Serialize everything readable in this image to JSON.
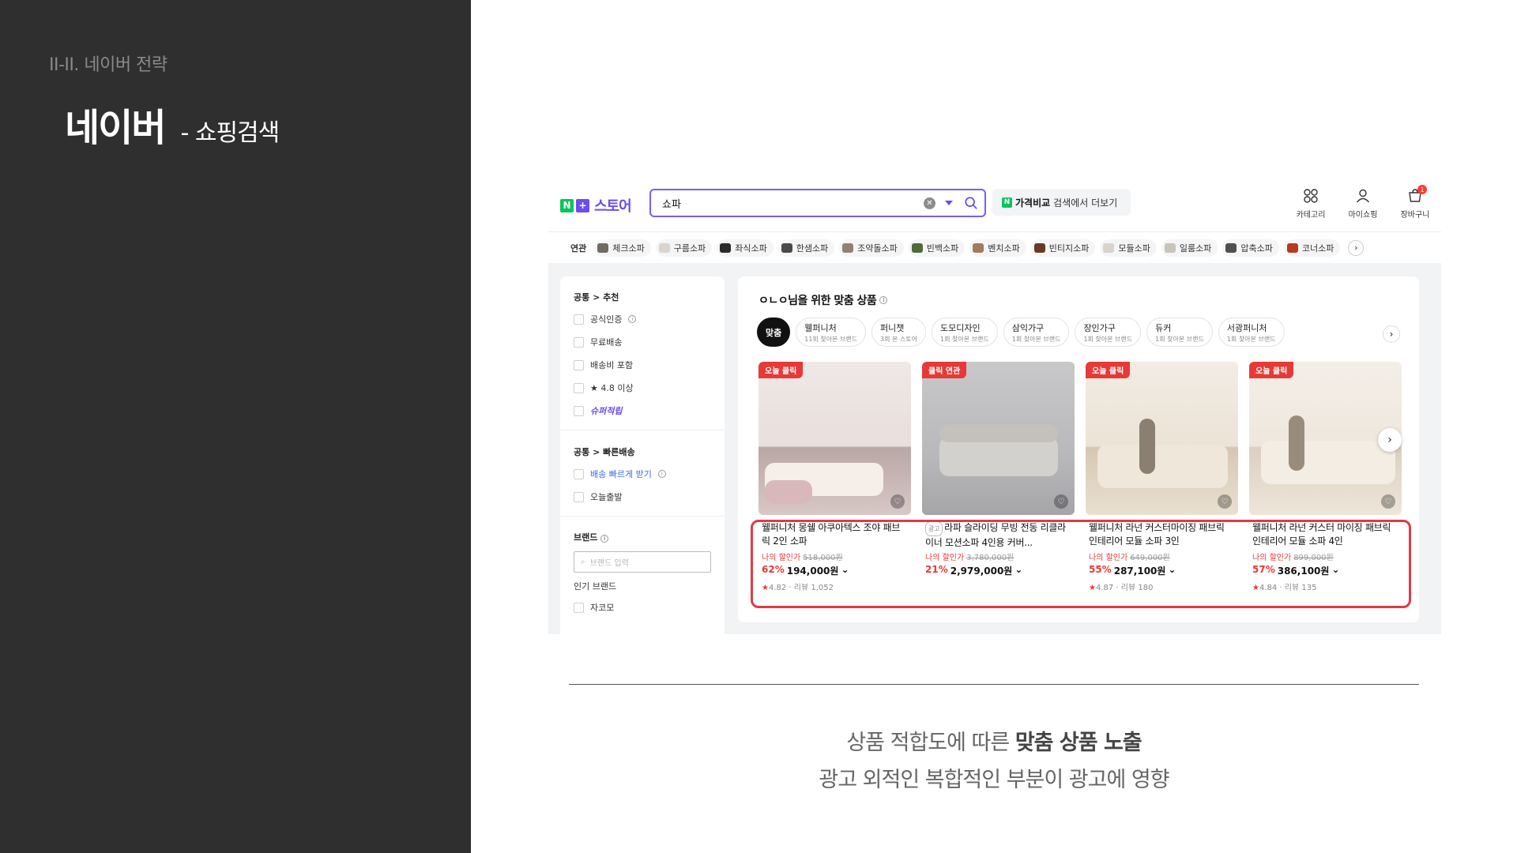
{
  "slide": {
    "section": "II-II. 네이버 전략",
    "title": "네이버",
    "subtitle": "- 쇼핑검색",
    "caption_line1_pre": "상품 적합도에 따른 ",
    "caption_line1_bold": "맞춤 상품 노출",
    "caption_line2": "광고 외적인 복합적인 부분이 광고에 영향"
  },
  "store": {
    "logo_text": "스토어",
    "search_value": "쇼파",
    "compare_bold": "가격비교",
    "compare_rest": "검색에서 더보기",
    "top_icons": [
      {
        "name": "category-icon",
        "label": "카테고리"
      },
      {
        "name": "user-icon",
        "label": "마이쇼핑"
      },
      {
        "name": "cart-icon",
        "label": "장바구니"
      }
    ],
    "cart_count": "1"
  },
  "related": {
    "label": "연관",
    "chips": [
      "체크소파",
      "구름소파",
      "좌식소파",
      "한샘소파",
      "조약돌소파",
      "빈백소파",
      "벤치소파",
      "빈티지소파",
      "모듈소파",
      "일룸소파",
      "압축소파",
      "코너소파"
    ]
  },
  "filters": {
    "section1": "공통 > 추천",
    "items1": [
      "공식인증",
      "무료배송",
      "배송비 포함",
      "★ 4.8 이상",
      "슈퍼적립"
    ],
    "section2": "공통 > 빠른배송",
    "fast_delivery": "배송 빠르게 받기",
    "today_ship": "오늘출발",
    "brand_title": "브랜드",
    "brand_placeholder": "브랜드 입력",
    "popular_brand": "인기 브랜드",
    "brand_item": "자코모"
  },
  "recommend": {
    "title": "ㅇㄴㅇ님을 위한 맞춤 상품",
    "active_tab": "맞춤",
    "tabs": [
      {
        "name": "웰퍼니처",
        "sub": "11회 찾아본 브랜드"
      },
      {
        "name": "퍼니챗",
        "sub": "3회 본 스토어"
      },
      {
        "name": "도모디자인",
        "sub": "1회 찾아본 브랜드"
      },
      {
        "name": "삼익가구",
        "sub": "1회 찾아본 브랜드"
      },
      {
        "name": "장인가구",
        "sub": "1회 찾아본 브랜드"
      },
      {
        "name": "듀커",
        "sub": "1회 찾아본 브랜드"
      },
      {
        "name": "서광퍼니처",
        "sub": "1회 찾아본 브랜드"
      }
    ],
    "products": [
      {
        "badge": "오늘 클릭",
        "ad": "",
        "name": "웰퍼니처 몽쉘 아쿠아텍스 조야 패브릭 2인 소파",
        "discount_label": "나의 할인가",
        "orig": "518,000원",
        "rate": "62%",
        "price": "194,000원",
        "rating": "4.82",
        "reviews": "리뷰 1,052"
      },
      {
        "badge": "클릭 연관",
        "ad": "광고",
        "name": "라파 슬라이딩 무빙 전동 리클라이너 모션소파 4인용 커버...",
        "discount_label": "나의 할인가",
        "orig": "3,780,000원",
        "rate": "21%",
        "price": "2,979,000원",
        "rating": "",
        "reviews": ""
      },
      {
        "badge": "오늘 클릭",
        "ad": "",
        "name": "웰퍼니처 라넌 커스터마이징 패브릭 인테리어 모듈 소파 3인",
        "discount_label": "나의 할인가",
        "orig": "649,000원",
        "rate": "55%",
        "price": "287,100원",
        "rating": "4.87",
        "reviews": "리뷰 180"
      },
      {
        "badge": "오늘 클릭",
        "ad": "",
        "name": "웰퍼니처 라넌 커스터 마이징 패브릭 인테리어 모듈 소파 4인",
        "discount_label": "나의 할인가",
        "orig": "899,000원",
        "rate": "57%",
        "price": "386,100원",
        "rating": "4.84",
        "reviews": "리뷰 135"
      }
    ]
  },
  "colors": {
    "panel": "#2f2f2f",
    "accent": "#6b4cf0",
    "naver_green": "#03c75a",
    "sale_red": "#e73935",
    "highlight": "#e03a48"
  }
}
